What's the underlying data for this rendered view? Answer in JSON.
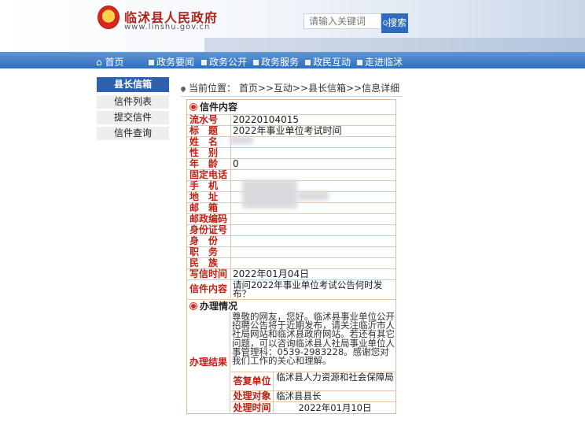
{
  "header": {
    "site_title": "临沭县人民政府",
    "site_domain": "www.linshu.gov.cn",
    "search_placeholder": "请输入关键词",
    "search_button": "搜索"
  },
  "nav": {
    "items": [
      "首页",
      "政务要闻",
      "政务公开",
      "政务服务",
      "政民互动",
      "走进临沭"
    ]
  },
  "sidebar": {
    "title": "县长信箱",
    "items": [
      "信件列表",
      "提交信件",
      "信件查询"
    ]
  },
  "breadcrumb": "当前位置： 首页>>互动>>县长信箱>>信息详细",
  "letter": {
    "section_title": "信件内容",
    "fields": [
      {
        "label": "流水号",
        "value": "20220104015"
      },
      {
        "label": "标　题",
        "value": "2022年事业单位考试时间"
      },
      {
        "label": "姓　名",
        "value": ""
      },
      {
        "label": "性　别",
        "value": ""
      },
      {
        "label": "年　龄",
        "value": "0"
      },
      {
        "label": "固定电话",
        "value": ""
      },
      {
        "label": "手　机",
        "value": ""
      },
      {
        "label": "地　址",
        "value": ""
      },
      {
        "label": "邮　箱",
        "value": ""
      },
      {
        "label": "邮政编码",
        "value": ""
      },
      {
        "label": "身份证号",
        "value": ""
      },
      {
        "label": "身　份",
        "value": ""
      },
      {
        "label": "职　务",
        "value": ""
      },
      {
        "label": "民　族",
        "value": ""
      },
      {
        "label": "写信时间",
        "value": "2022年01月04日"
      }
    ],
    "content_label": "信件内容",
    "content_value": "请问2022年事业单位考试公告何时发布？"
  },
  "handling": {
    "section_title": "办理情况",
    "result_label": "办理结果",
    "result_text": "尊敬的网友，您好。临沭县事业单位公开招聘公告将于近期发布，请关注临沂市人社局网站和临沭县政府网站。若还有其它问题，可以咨询临沭县人社局事业单位人事管理科：0539-2983228。感谢您对我们工作的关心和理解。",
    "reply_unit_label": "答复单位",
    "reply_unit_value": "临沭县人力资源和社会保障局",
    "target_label": "处理对象",
    "target_value": "临沭县县长",
    "time_label": "处理时间",
    "time_value": "2022年01月10日"
  }
}
